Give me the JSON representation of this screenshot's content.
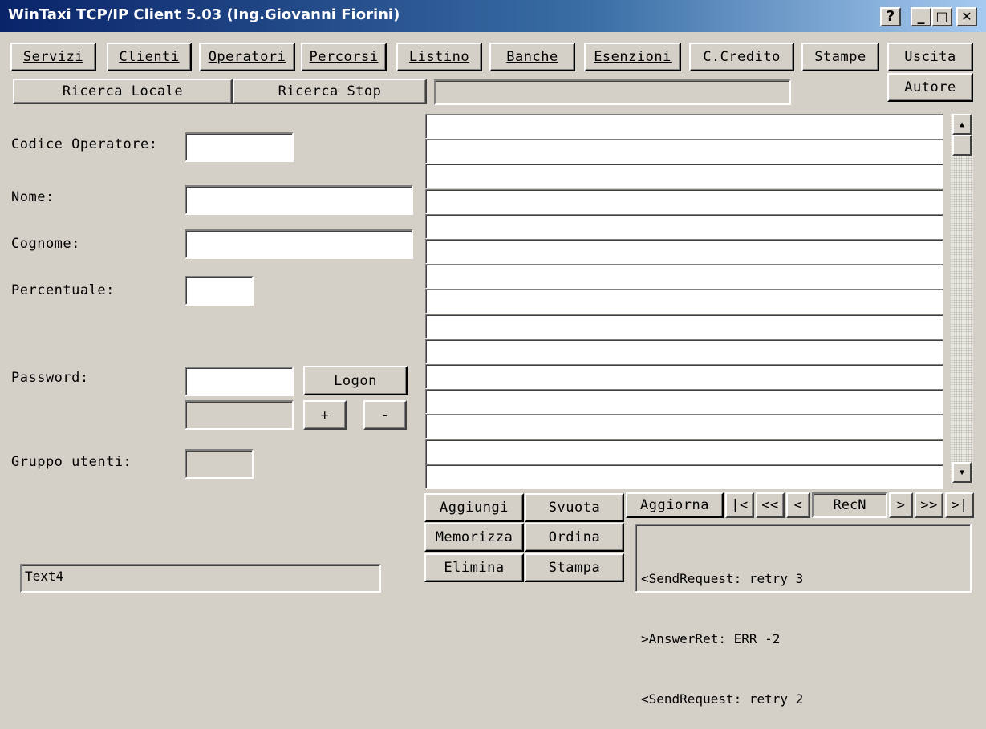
{
  "window": {
    "title": "WinTaxi TCP/IP Client 5.03 (Ing.Giovanni Fiorini)",
    "help_glyph": "?",
    "minimize_glyph": "_",
    "maximize_glyph": "□",
    "close_glyph": "✕"
  },
  "toolbar": {
    "servizi": "Servizi",
    "clienti": "Clienti",
    "operatori": "Operatori",
    "percorsi": "Percorsi",
    "listino": "Listino",
    "banche": "Banche",
    "esenzioni": "Esenzioni",
    "credito": "C.Credito",
    "stampe": "Stampe",
    "uscita": "Uscita",
    "autore": "Autore"
  },
  "search": {
    "ricerca_locale": "Ricerca Locale",
    "ricerca_stop": "Ricerca Stop",
    "status_value": ""
  },
  "form": {
    "codice_label": "Codice Operatore:",
    "codice_value": "",
    "nome_label": "Nome:",
    "nome_value": "",
    "cognome_label": "Cognome:",
    "cognome_value": "",
    "percentuale_label": "Percentuale:",
    "percentuale_value": "",
    "password_label": "Password:",
    "password_value": "",
    "logon": "Logon",
    "plus": "+",
    "minus": "-",
    "gruppo_label": "Gruppo utenti:",
    "gruppo_value": "",
    "text4_value": "Text4"
  },
  "list": {
    "rows": [
      "",
      "",
      "",
      "",
      "",
      "",
      "",
      "",
      "",
      "",
      "",
      "",
      "",
      "",
      ""
    ],
    "scroll_up": "▲",
    "scroll_down": "▼"
  },
  "actions": {
    "aggiungi": "Aggiungi",
    "svuota": "Svuota",
    "memorizza": "Memorizza",
    "ordina": "Ordina",
    "elimina": "Elimina",
    "stampa": "Stampa",
    "aggiorna": "Aggiorna"
  },
  "nav": {
    "first": "|<",
    "prev_page": "<<",
    "prev": "<",
    "recn": "RecN",
    "next": ">",
    "next_page": ">>",
    "last": ">|"
  },
  "log": {
    "lines": [
      "<SendRequest: retry 3",
      ">AnswerRet: ERR -2",
      "<SendRequest: retry 2"
    ]
  }
}
